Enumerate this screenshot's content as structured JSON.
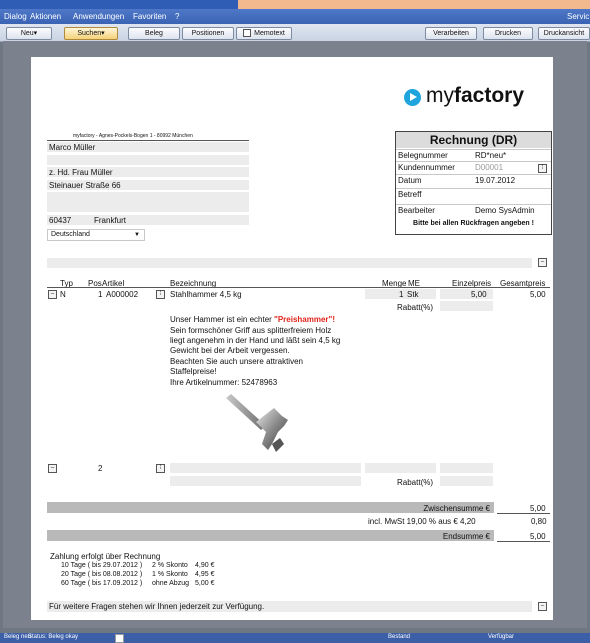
{
  "menu": [
    "Dialog",
    "Aktionen",
    "Anwendungen",
    "Favoriten",
    "?",
    "Servic"
  ],
  "toolbar": {
    "neu": "Neu▾",
    "suchen": "Suchen▾",
    "beleg": "Beleg",
    "positionen": "Positionen",
    "memotext": "Memotext",
    "verarbeiten": "Verarbeiten",
    "drucken": "Drucken",
    "druckansicht": "Druckansicht"
  },
  "logo": {
    "my": "my",
    "factory": "factory"
  },
  "sender_line": "myfactory - Agnes-Pockels-Bogen 1 - 80992 München",
  "address": {
    "name": "Marco Müller",
    "line2": "",
    "attention": "z. Hd. Frau Müller",
    "street": "Steinauer Straße 66",
    "zip": "60437",
    "city": "Frankfurt",
    "country": "Deutschland"
  },
  "invoice_box": {
    "title": "Rechnung (DR)",
    "rows": [
      {
        "label": "Belegnummer",
        "value": "RD*neu*"
      },
      {
        "label": "Kundennummer",
        "value": "D00001"
      },
      {
        "label": "Datum",
        "value": "19.07.2012"
      },
      {
        "label": "Betreff",
        "value": ""
      },
      {
        "label": "Bearbeiter",
        "value": "Demo SysAdmin"
      }
    ],
    "note": "Bitte bei allen Rückfragen angeben !"
  },
  "table": {
    "headers": {
      "typ": "Typ",
      "pos": "Pos",
      "artikel": "Artikel",
      "bez": "Bezeichnung",
      "menge": "Menge",
      "me": "ME",
      "ep": "Einzelpreis",
      "gp": "Gesamtpreis"
    },
    "row1": {
      "typ": "N",
      "pos": "1",
      "artikel": "A000002",
      "bez": "Stahlhammer 4,5 kg",
      "menge": "1",
      "me": "Stk",
      "ep": "5,00",
      "gp": "5,00",
      "rabatt": "Rabatt(%)"
    },
    "desc_prefix": "Unser Hammer ist ein echter ",
    "desc_highlight": "\"Preishammer\"!",
    "desc_lines": [
      "Sein formschöner Griff aus splitterfreiem Holz",
      "liegt angenehm in der Hand und läßt sein 4,5 kg",
      "Gewicht bei der Arbeit vergessen.",
      "Beachten Sie auch unsere attraktiven",
      "Staffelpreise!",
      "Ihre Artikelnummer: 52478963"
    ],
    "row2": {
      "pos": "2",
      "rabatt": "Rabatt(%)"
    }
  },
  "totals": {
    "zwischensumme_label": "Zwischensumme €",
    "zwischensumme": "5,00",
    "mwst_label": "incl. MwSt 19,00 % aus € 4,20",
    "mwst": "0,80",
    "endsumme_label": "Endsumme €",
    "endsumme": "5,00"
  },
  "payment": {
    "title": "Zahlung erfolgt über Rechnung",
    "terms": [
      {
        "a": "10 Tage ( bis 29.07.2012 )",
        "b": "2 % Skonto",
        "c": "4,90 €"
      },
      {
        "a": "20 Tage ( bis 08.08.2012 )",
        "b": "1 % Skonto",
        "c": "4,95 €"
      },
      {
        "a": "60 Tage ( bis 17.09.2012 )",
        "b": "ohne Abzug",
        "c": "5,00 €"
      }
    ]
  },
  "footer_text": "Für weitere Fragen stehen wir Ihnen jederzeit zur Verfügung.",
  "status": {
    "beleg_neu": "Beleg neu",
    "status": "Status: Beleg okay",
    "bestand": "Bestand",
    "verfuegbar": "Verfügbar"
  }
}
